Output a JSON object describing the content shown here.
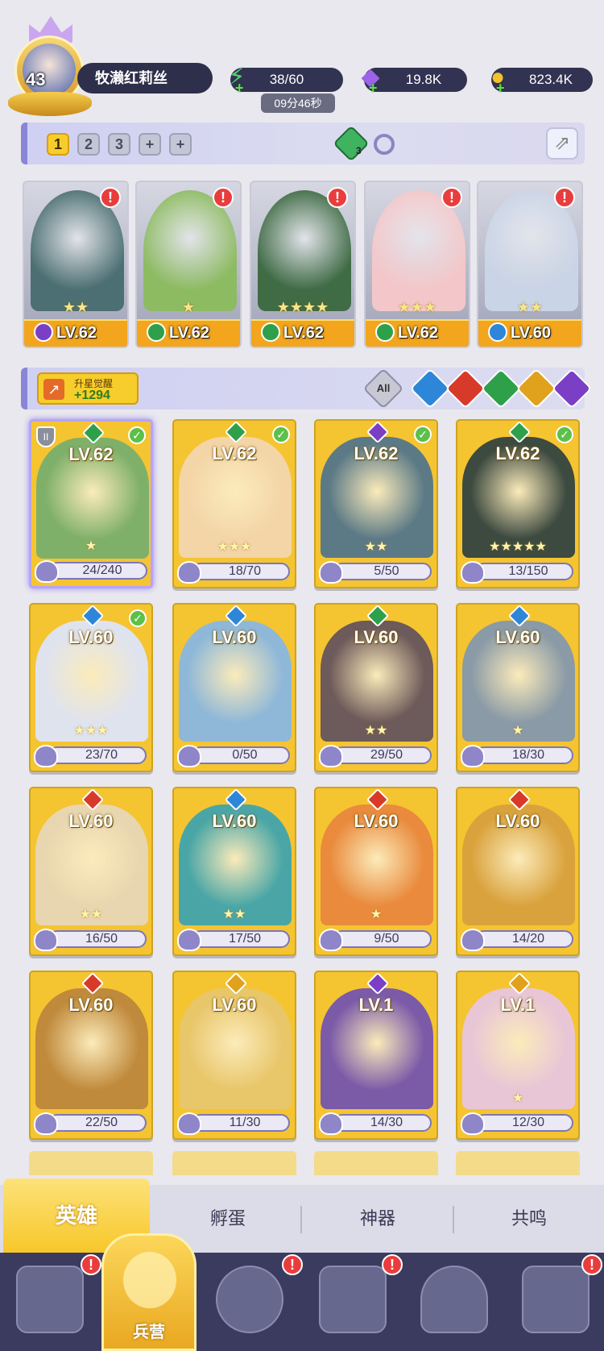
{
  "player": {
    "level": "43",
    "name": "牧濑红莉丝"
  },
  "resources": {
    "energy": "38/60",
    "energy_timer": "09分46秒",
    "gems": "19.8K",
    "gold": "823.4K"
  },
  "team": {
    "slots": [
      "1",
      "2",
      "3",
      "+",
      "+"
    ],
    "active_slot": "1",
    "gem_count": "3",
    "cards": [
      {
        "level": "LV.62",
        "stars": "★★",
        "element": "dark",
        "color": "#4b6f72"
      },
      {
        "level": "LV.62",
        "stars": "★",
        "element": "nature",
        "color": "#8dbb62"
      },
      {
        "level": "LV.62",
        "stars": "★★★★",
        "element": "nature",
        "color": "#3f6b45"
      },
      {
        "level": "LV.62",
        "stars": "★★★",
        "element": "nature",
        "color": "#f3c7c9"
      },
      {
        "level": "LV.60",
        "stars": "★★",
        "element": "water",
        "color": "#c9d4e6"
      }
    ]
  },
  "filter": {
    "star_up_label": "升星觉醒",
    "star_up_value": "+1294",
    "all_label": "All",
    "elements": [
      {
        "name": "water",
        "color": "#2e86d8"
      },
      {
        "name": "fire",
        "color": "#d83a2a"
      },
      {
        "name": "nature",
        "color": "#2fa04a"
      },
      {
        "name": "light",
        "color": "#e0a11c"
      },
      {
        "name": "dark",
        "color": "#7a3fc4"
      }
    ]
  },
  "heroes": [
    {
      "level": "LV.62",
      "fragments": "24/240",
      "stars": "★",
      "element_color": "#2fa04a",
      "checked": true,
      "color": "#7fb06a"
    },
    {
      "level": "LV.62",
      "fragments": "18/70",
      "stars": "★★★",
      "element_color": "#2fa04a",
      "checked": true,
      "color": "#f3d5a8"
    },
    {
      "level": "LV.62",
      "fragments": "5/50",
      "stars": "★★",
      "element_color": "#7a3fc4",
      "checked": true,
      "color": "#5c7a86"
    },
    {
      "level": "LV.62",
      "fragments": "13/150",
      "stars": "★★★★★",
      "element_color": "#2fa04a",
      "checked": true,
      "color": "#3d4a40"
    },
    {
      "level": "LV.60",
      "fragments": "23/70",
      "stars": "★★★",
      "element_color": "#2e86d8",
      "checked": true,
      "color": "#dfe3ee"
    },
    {
      "level": "LV.60",
      "fragments": "0/50",
      "stars": "",
      "element_color": "#2e86d8",
      "checked": false,
      "color": "#8fb8d8"
    },
    {
      "level": "LV.60",
      "fragments": "29/50",
      "stars": "★★",
      "element_color": "#2fa04a",
      "checked": false,
      "color": "#6d5a5a"
    },
    {
      "level": "LV.60",
      "fragments": "18/30",
      "stars": "★",
      "element_color": "#2e86d8",
      "checked": false,
      "color": "#8a9aa6"
    },
    {
      "level": "LV.60",
      "fragments": "16/50",
      "stars": "★★",
      "element_color": "#d83a2a",
      "checked": false,
      "color": "#e8d6b0"
    },
    {
      "level": "LV.60",
      "fragments": "17/50",
      "stars": "★★",
      "element_color": "#2e86d8",
      "checked": false,
      "color": "#4aa6a6"
    },
    {
      "level": "LV.60",
      "fragments": "9/50",
      "stars": "★",
      "element_color": "#d83a2a",
      "checked": false,
      "color": "#e98a3c"
    },
    {
      "level": "LV.60",
      "fragments": "14/20",
      "stars": "",
      "element_color": "#d83a2a",
      "checked": false,
      "color": "#d9a23c"
    },
    {
      "level": "LV.60",
      "fragments": "22/50",
      "stars": "",
      "element_color": "#d83a2a",
      "checked": false,
      "color": "#c08a3c"
    },
    {
      "level": "LV.60",
      "fragments": "11/30",
      "stars": "",
      "element_color": "#e0a11c",
      "checked": false,
      "color": "#e8c66a"
    },
    {
      "level": "LV.1",
      "fragments": "14/30",
      "stars": "",
      "element_color": "#7a3fc4",
      "checked": false,
      "color": "#7b5aa8"
    },
    {
      "level": "LV.1",
      "fragments": "12/30",
      "stars": "★",
      "element_color": "#e0a11c",
      "checked": false,
      "color": "#e8c6d6"
    }
  ],
  "tabs": [
    "英雄",
    "孵蛋",
    "神器",
    "共鸣"
  ],
  "nav": {
    "active_label": "兵营"
  }
}
